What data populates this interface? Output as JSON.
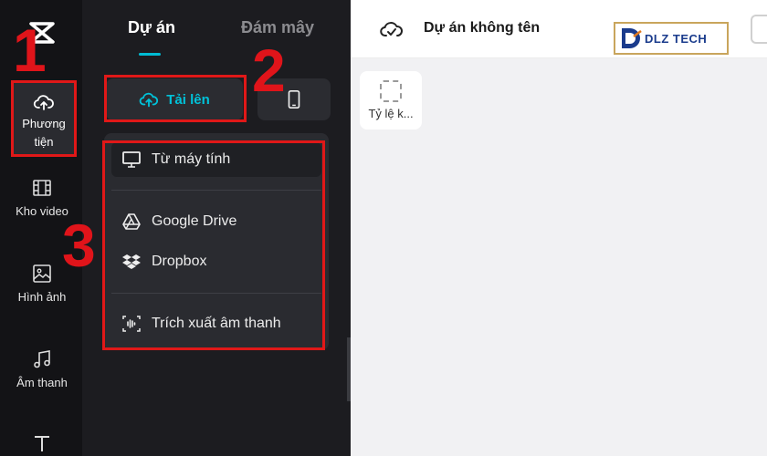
{
  "rail": {
    "items": [
      {
        "label": "Phương tiện",
        "icon": "cloud-upload-icon",
        "active": true
      },
      {
        "label": "Kho video",
        "icon": "film-icon"
      },
      {
        "label": "Hình ảnh",
        "icon": "image-icon"
      },
      {
        "label": "Âm thanh",
        "icon": "music-note-icon"
      },
      {
        "label": "",
        "icon": "text-icon"
      }
    ]
  },
  "panel": {
    "tabs": [
      {
        "label": "Dự án",
        "active": true
      },
      {
        "label": "Đám mây",
        "active": false
      }
    ],
    "upload_label": "Tải lên",
    "menu": [
      {
        "label": "Từ máy tính",
        "icon": "monitor-icon"
      },
      {
        "label": "Google Drive",
        "icon": "google-drive-icon"
      },
      {
        "label": "Dropbox",
        "icon": "dropbox-icon"
      },
      {
        "label": "Trích xuất âm thanh",
        "icon": "audio-wave-icon"
      }
    ]
  },
  "header": {
    "title": "Dự án không tên",
    "brand": "DLZ TECH"
  },
  "canvas": {
    "ratio_label": "Tỷ lệ k..."
  },
  "annotations": {
    "n1": "1",
    "n2": "2",
    "n3": "3"
  },
  "colors": {
    "accent": "#00c2d9",
    "annotation": "#e01818",
    "rail_bg": "#131316",
    "panel_bg": "#1c1c20"
  }
}
